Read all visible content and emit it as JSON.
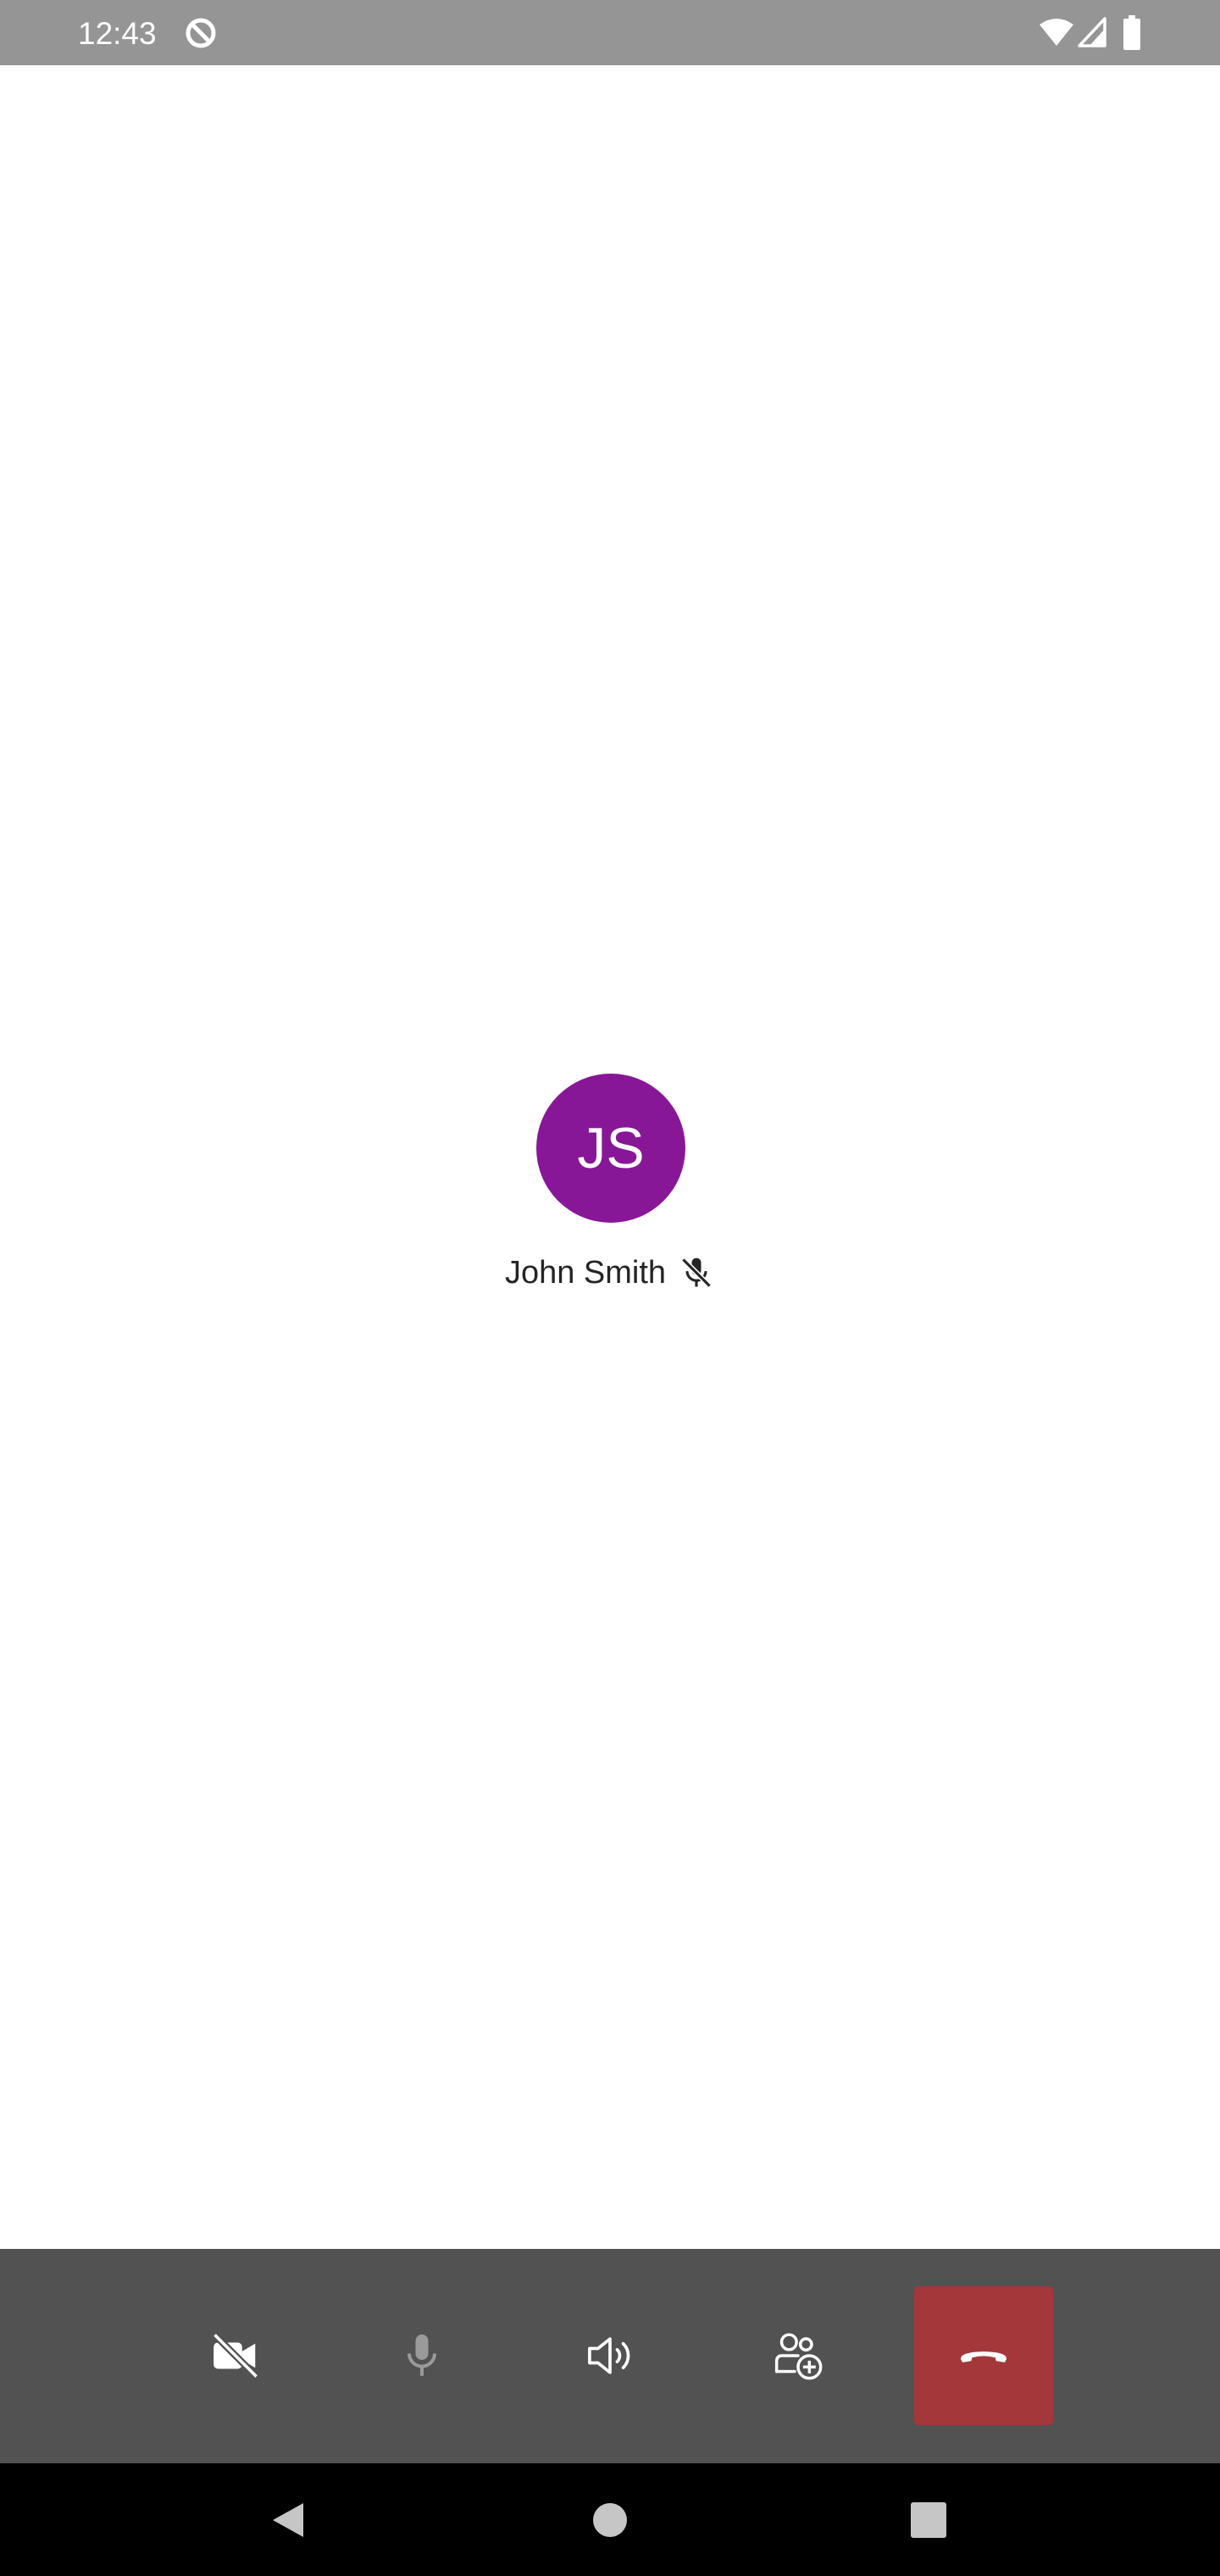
{
  "status_bar": {
    "time": "12:43",
    "icons": [
      "do-not-disturb-icon",
      "wifi-icon",
      "signal-icon",
      "battery-icon"
    ]
  },
  "participant": {
    "initials": "JS",
    "name": "John Smith",
    "muted": true,
    "avatar_color": "#881798"
  },
  "controls": [
    {
      "icon": "camera-off-icon",
      "state": "off"
    },
    {
      "icon": "microphone-icon",
      "state": "disabled"
    },
    {
      "icon": "speaker-icon",
      "state": "on"
    },
    {
      "icon": "add-people-icon",
      "state": "enabled"
    },
    {
      "icon": "hang-up-icon",
      "state": "danger"
    }
  ],
  "navigation": [
    "back-icon",
    "home-icon",
    "recents-icon"
  ],
  "colors": {
    "status_bar": "#959595",
    "call_background": "#ffffff",
    "control_bar": "#525252",
    "hang_up": "#a4373a",
    "nav_bar": "#000000",
    "disabled_icon": "#9a9a9a"
  }
}
